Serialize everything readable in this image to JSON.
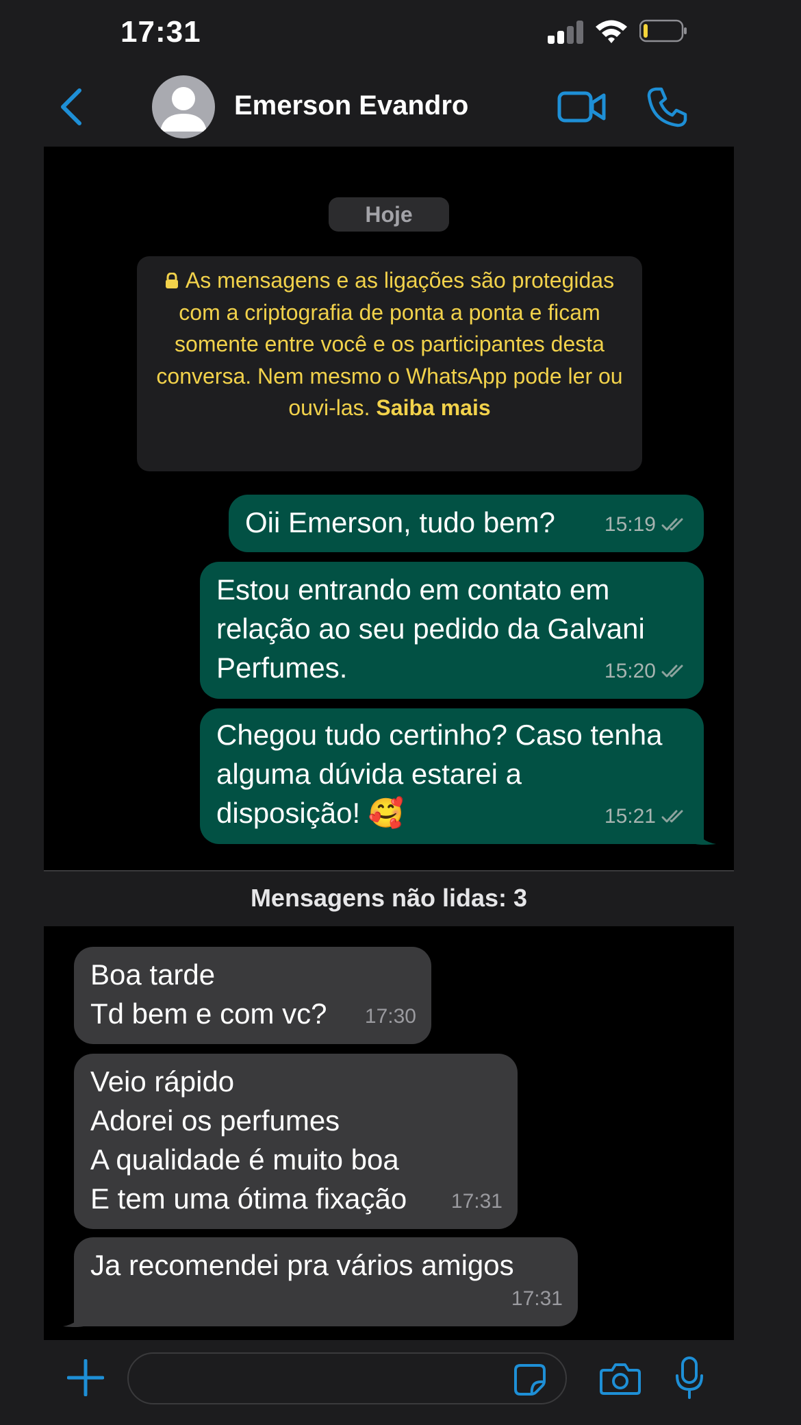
{
  "status_bar": {
    "time": "17:31"
  },
  "header": {
    "contact_name": "Emerson Evandro"
  },
  "chat": {
    "date_label": "Hoje",
    "encryption_notice": {
      "text": "As mensagens e as ligações são protegidas com a criptografia de ponta a ponta e ficam somente entre você e os participantes desta conversa. Nem mesmo o WhatsApp pode ler ou ouvi-las.",
      "link": "Saiba mais"
    },
    "outgoing": [
      {
        "lines": [
          "Oii Emerson, tudo bem?"
        ],
        "time": "15:19",
        "status": "read"
      },
      {
        "lines": [
          "Estou entrando em contato em",
          "relação ao seu pedido da Galvani",
          "Perfumes."
        ],
        "time": "15:20",
        "status": "read"
      },
      {
        "lines": [
          "Chegou tudo certinho? Caso tenha",
          "alguma dúvida estarei a",
          "disposição! 🥰"
        ],
        "time": "15:21",
        "status": "read"
      }
    ],
    "unread_label": "Mensagens não lidas: 3",
    "incoming": [
      {
        "lines": [
          "Boa tarde",
          "Td bem e com vc?"
        ],
        "time": "17:30"
      },
      {
        "lines": [
          "Veio rápido",
          "Adorei os perfumes",
          "A qualidade é muito boa",
          "E tem uma ótima fixação"
        ],
        "time": "17:31"
      },
      {
        "lines": [
          "Ja recomendei pra vários amigos"
        ],
        "time": "17:31"
      }
    ]
  },
  "input": {
    "placeholder": ""
  },
  "colors": {
    "accent": "#1e8fd6",
    "outgoing_bubble": "#025144",
    "incoming_bubble": "#3a3a3c",
    "notice_text": "#f2d24b",
    "background": "#000000"
  },
  "icons": [
    "back-arrow-icon",
    "avatar-placeholder-icon",
    "video-camera-icon",
    "phone-icon",
    "lock-icon",
    "double-check-icon",
    "plus-icon",
    "sticker-icon",
    "camera-icon",
    "microphone-icon",
    "signal-icon",
    "wifi-icon",
    "battery-icon"
  ]
}
